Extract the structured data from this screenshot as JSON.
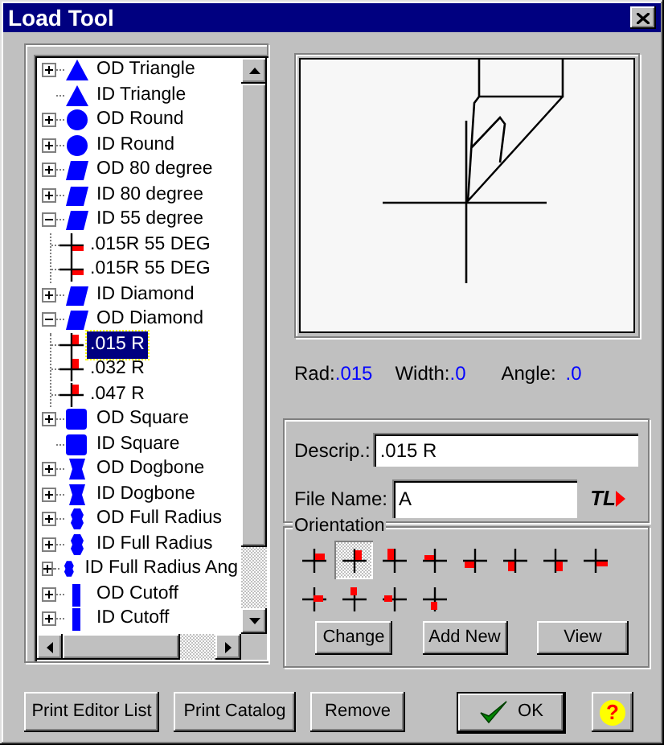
{
  "window": {
    "title": "Load Tool"
  },
  "tree": [
    {
      "label": "OD Triangle",
      "kind": "triangle",
      "expanded": false,
      "selected": false
    },
    {
      "label": "ID Triangle",
      "kind": "triangle",
      "selected": false
    },
    {
      "label": "OD Round",
      "kind": "round",
      "expanded": false,
      "selected": false
    },
    {
      "label": "ID Round",
      "kind": "round",
      "expanded": false,
      "selected": false
    },
    {
      "label": "OD 80 degree",
      "kind": "parallelogram",
      "expanded": false,
      "selected": false
    },
    {
      "label": "ID 80 degree",
      "kind": "parallelogram",
      "expanded": false,
      "selected": false
    },
    {
      "label": "ID 55 degree",
      "kind": "parallelogram",
      "expanded": true,
      "selected": false,
      "children": [
        {
          "label": ".015R 55 DEG",
          "kind": "lr-h",
          "selected": false
        },
        {
          "label": ".015R 55 DEG",
          "kind": "lr-h",
          "selected": false
        }
      ]
    },
    {
      "label": "ID Diamond",
      "kind": "parallelogram",
      "expanded": false,
      "selected": false
    },
    {
      "label": "OD Diamond",
      "kind": "parallelogram",
      "expanded": true,
      "selected": false,
      "children": [
        {
          "label": ".015 R",
          "kind": "qr-v",
          "selected": true
        },
        {
          "label": ".032 R",
          "kind": "qr-v",
          "selected": false
        },
        {
          "label": ".047 R",
          "kind": "qr-v",
          "selected": false
        }
      ]
    },
    {
      "label": "OD Square",
      "kind": "square",
      "expanded": false,
      "selected": false
    },
    {
      "label": "ID Square",
      "kind": "square",
      "selected": false
    },
    {
      "label": "OD Dogbone",
      "kind": "dogbone",
      "expanded": false,
      "selected": false
    },
    {
      "label": "ID Dogbone",
      "kind": "dogbone",
      "expanded": false,
      "selected": false
    },
    {
      "label": "OD Full Radius",
      "kind": "fullradius",
      "expanded": false,
      "selected": false
    },
    {
      "label": "ID Full Radius",
      "kind": "fullradius",
      "expanded": false,
      "selected": false
    },
    {
      "label": "ID Full Radius Ang",
      "kind": "fullradius",
      "expanded": false,
      "selected": false
    },
    {
      "label": "OD Cutoff",
      "kind": "cutoff",
      "expanded": false,
      "selected": false
    },
    {
      "label": "ID Cutoff",
      "kind": "cutoff",
      "expanded": false,
      "selected": false
    }
  ],
  "preview": {
    "rad_label": "Rad:",
    "rad": ".015",
    "width_label": "Width:",
    "width": ".0",
    "angle_label": "Angle:",
    "angle": ".0"
  },
  "descrip": {
    "label": "Descrip.:",
    "value": ".015 R"
  },
  "file_name": {
    "label": "File Name:",
    "value": "A",
    "tag": "TL"
  },
  "orientation": {
    "title": "Orientation",
    "options": [
      {
        "kind": "qr-h",
        "selected": false
      },
      {
        "kind": "qr-v",
        "selected": true
      },
      {
        "kind": "ql-v",
        "selected": false
      },
      {
        "kind": "ql-h",
        "selected": false
      },
      {
        "kind": "ll-h",
        "selected": false
      },
      {
        "kind": "ll-v",
        "selected": false
      },
      {
        "kind": "lr-v",
        "selected": false
      },
      {
        "kind": "lr-h",
        "selected": false
      },
      {
        "kind": "r",
        "selected": false
      },
      {
        "kind": "t",
        "selected": false
      },
      {
        "kind": "l",
        "selected": false
      },
      {
        "kind": "b",
        "selected": false
      }
    ],
    "buttons": [
      "Change",
      "Add New",
      "View"
    ]
  },
  "buttons": [
    "Print Editor List",
    "Print Catalog",
    "Remove"
  ],
  "ok": "OK",
  "help": "?"
}
